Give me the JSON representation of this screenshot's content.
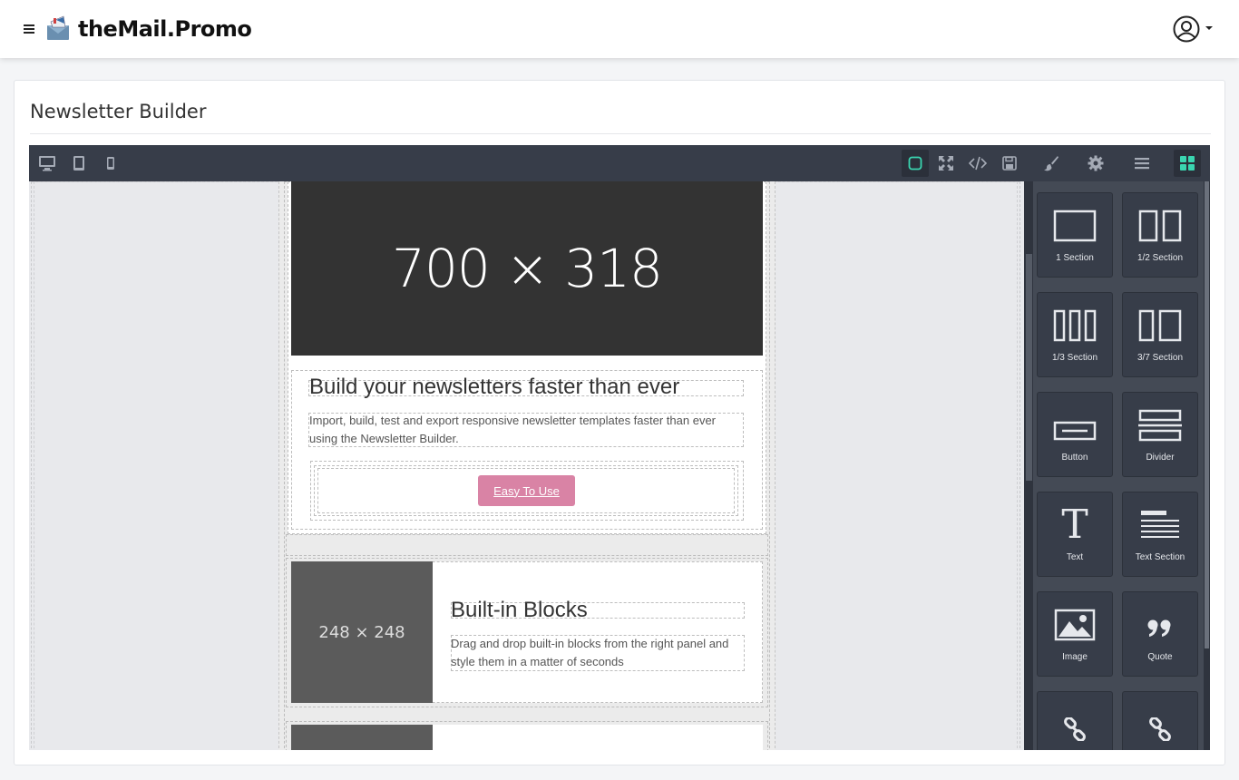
{
  "navbar": {
    "brand": "theMail.Promo"
  },
  "page": {
    "title": "Newsletter Builder"
  },
  "toolbar": {
    "devices": [
      "desktop-icon",
      "tablet-icon",
      "mobile-icon"
    ],
    "actions": [
      "sw-visibility-icon",
      "fullscreen-icon",
      "code-icon",
      "save-icon"
    ],
    "panels": [
      "style-manager-icon",
      "settings-icon",
      "layer-manager-icon",
      "blocks-icon"
    ],
    "accent_color": "#3ad5b0"
  },
  "canvas": {
    "hero_placeholder": "700 × 318",
    "heading": "Build your newsletters faster than ever",
    "paragraph_line1": "Import, build, test and export responsive newsletter templates faster than ever",
    "paragraph_line2": "using the Newsletter Builder.",
    "cta_label": "Easy To Use",
    "cta_color": "#d983a5",
    "thumb_placeholder": "248 × 248",
    "block_heading": "Built-in Blocks",
    "block_text_line1": "Drag and drop built-in blocks from the right panel and",
    "block_text_line2": "style them in a matter of seconds"
  },
  "blocks": [
    {
      "label": "1 Section",
      "icon": "one-section-icon"
    },
    {
      "label": "1/2 Section",
      "icon": "half-section-icon"
    },
    {
      "label": "1/3 Section",
      "icon": "third-section-icon"
    },
    {
      "label": "3/7 Section",
      "icon": "three-seven-section-icon"
    },
    {
      "label": "Button",
      "icon": "button-block-icon"
    },
    {
      "label": "Divider",
      "icon": "divider-block-icon"
    },
    {
      "label": "Text",
      "icon": "text-block-icon"
    },
    {
      "label": "Text Section",
      "icon": "text-section-icon"
    },
    {
      "label": "Image",
      "icon": "image-block-icon"
    },
    {
      "label": "Quote",
      "icon": "quote-block-icon"
    },
    {
      "label": "",
      "icon": "link-block-icon"
    },
    {
      "label": "",
      "icon": "link-block-block-icon"
    }
  ]
}
